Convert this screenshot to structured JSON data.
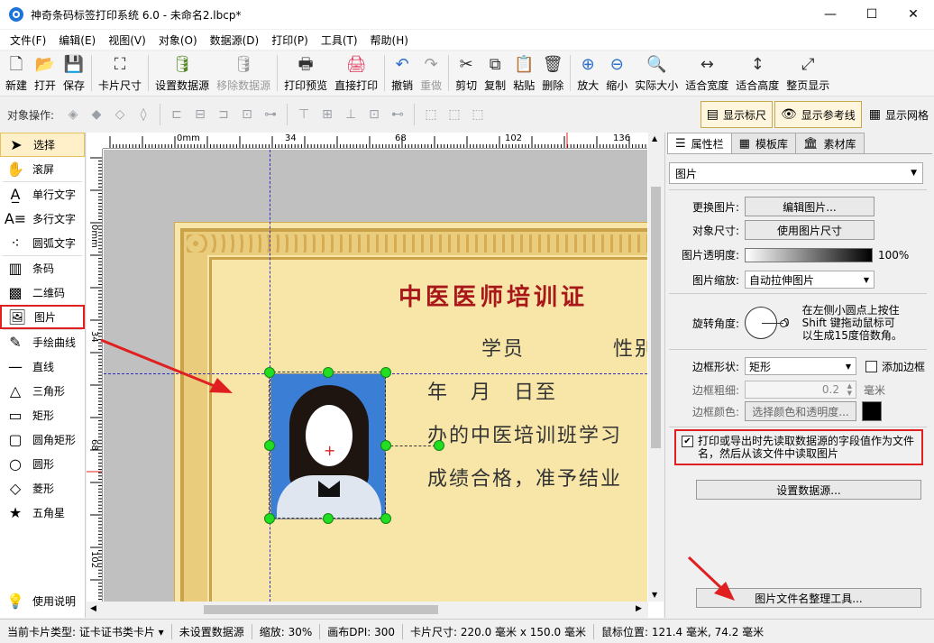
{
  "window": {
    "title": "神奇条码标签打印系统 6.0 - 未命名2.lbcp*",
    "minimize": "—",
    "maximize": "☐",
    "close": "✕"
  },
  "menu": [
    "文件(F)",
    "编辑(E)",
    "视图(V)",
    "对象(O)",
    "数据源(D)",
    "打印(P)",
    "工具(T)",
    "帮助(H)"
  ],
  "toolbar": [
    {
      "label": "新建",
      "icon": "new-file-icon",
      "glyph": "🗋"
    },
    {
      "label": "打开",
      "icon": "open-file-icon",
      "glyph": "📂"
    },
    {
      "label": "保存",
      "icon": "save-icon",
      "glyph": "💾"
    },
    {
      "label": "卡片尺寸",
      "icon": "card-size-icon",
      "glyph": "⛶"
    },
    {
      "label": "设置数据源",
      "icon": "database-icon",
      "glyph": "🛢"
    },
    {
      "label": "移除数据源",
      "icon": "remove-database-icon",
      "glyph": "🛢",
      "disabled": true
    },
    {
      "label": "打印预览",
      "icon": "print-preview-icon",
      "glyph": "🖶"
    },
    {
      "label": "直接打印",
      "icon": "printer-icon",
      "glyph": "🖨"
    },
    {
      "label": "撤销",
      "icon": "undo-icon",
      "glyph": "↶"
    },
    {
      "label": "重做",
      "icon": "redo-icon",
      "glyph": "↷",
      "disabled": true
    },
    {
      "label": "剪切",
      "icon": "scissors-icon",
      "glyph": "✂"
    },
    {
      "label": "复制",
      "icon": "copy-icon",
      "glyph": "⧉"
    },
    {
      "label": "粘贴",
      "icon": "paste-icon",
      "glyph": "📋"
    },
    {
      "label": "删除",
      "icon": "trash-icon",
      "glyph": "🗑"
    },
    {
      "label": "放大",
      "icon": "zoom-in-icon",
      "glyph": "⊕"
    },
    {
      "label": "缩小",
      "icon": "zoom-out-icon",
      "glyph": "⊖"
    },
    {
      "label": "实际大小",
      "icon": "actual-size-icon",
      "glyph": "🔍"
    },
    {
      "label": "适合宽度",
      "icon": "fit-width-icon",
      "glyph": "↔"
    },
    {
      "label": "适合高度",
      "icon": "fit-height-icon",
      "glyph": "↕"
    },
    {
      "label": "整页显示",
      "icon": "fit-page-icon",
      "glyph": "⤢"
    }
  ],
  "toolbar2": {
    "label": "对象操作:",
    "show_ruler": "显示标尺",
    "show_guides": "显示参考线",
    "show_grid": "显示网格"
  },
  "tools": [
    "选择",
    "滚屏",
    "单行文字",
    "多行文字",
    "圆弧文字",
    "条码",
    "二维码",
    "图片",
    "手绘曲线",
    "直线",
    "三角形",
    "矩形",
    "圆角矩形",
    "圆形",
    "菱形",
    "五角星",
    "使用说明"
  ],
  "ruler": {
    "top": [
      "0mm",
      "34",
      "68",
      "102",
      "136"
    ],
    "left": [
      "0mm",
      "34",
      "68",
      "102"
    ]
  },
  "certificate": {
    "title": "中医医师培训证",
    "line1a": "学员",
    "line1b": "性别",
    "line2": "年　月　日至",
    "line3": "办的中医培训班学习",
    "line4": "成绩合格，准予结业"
  },
  "tabs": [
    "属性栏",
    "模板库",
    "素材库"
  ],
  "props": {
    "object_type": "图片",
    "change_image_label": "更换图片:",
    "edit_image_btn": "编辑图片...",
    "object_size_label": "对象尺寸:",
    "use_image_size_btn": "使用图片尺寸",
    "opacity_label": "图片透明度:",
    "opacity_value": "100%",
    "scale_label": "图片缩放:",
    "scale_value": "自动拉伸图片",
    "rotation_label": "旋转角度:",
    "rotation_value": "0",
    "rotation_hint": "在左侧小圆点上按住 Shift 键拖动鼠标可以生成15度倍数角。",
    "border_shape_label": "边框形状:",
    "border_shape_value": "矩形",
    "add_border_label": "添加边框",
    "border_width_label": "边框粗细:",
    "border_width_value": "0.2",
    "border_width_unit": "毫米",
    "border_color_label": "边框颜色:",
    "border_color_btn": "选择颜色和透明度...",
    "read_datasource_text": "打印或导出时先读取数据源的字段值作为文件名，然后从该文件中读取图片",
    "set_datasource_btn": "设置数据源...",
    "rename_tool_btn": "图片文件名整理工具..."
  },
  "status": [
    "当前卡片类型: 证卡证书类卡片 ▾",
    "未设置数据源",
    "缩放: 30%",
    "画布DPI: 300",
    "卡片尺寸: 220.0 毫米 x 150.0 毫米",
    "鼠标位置: 121.4 毫米, 74.2 毫米"
  ]
}
